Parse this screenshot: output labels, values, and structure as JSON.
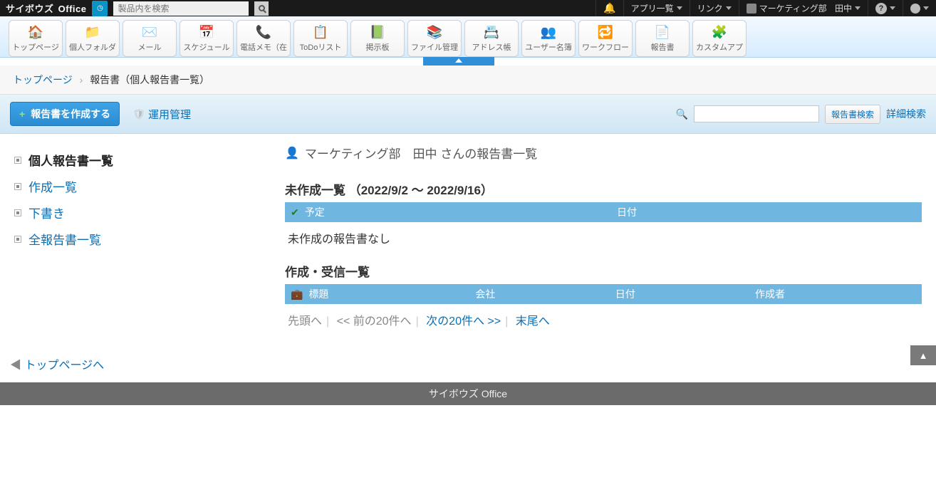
{
  "top": {
    "logo_small": "サイボウズ",
    "logo_main": "Office",
    "search_placeholder": "製品内を検索",
    "apps_label": "アプリ一覧",
    "links_label": "リンク",
    "user_dept": "マーケティング部",
    "user_name": "田中"
  },
  "apps": [
    {
      "label": "トップページ",
      "icon": "🏠"
    },
    {
      "label": "個人フォルダ",
      "icon": "📁"
    },
    {
      "label": "メール",
      "icon": "✉️"
    },
    {
      "label": "スケジュール",
      "icon": "📅"
    },
    {
      "label": "電話メモ（在",
      "icon": "📞"
    },
    {
      "label": "ToDoリスト",
      "icon": "📋"
    },
    {
      "label": "掲示板",
      "icon": "📗"
    },
    {
      "label": "ファイル管理",
      "icon": "📚"
    },
    {
      "label": "アドレス帳",
      "icon": "📇"
    },
    {
      "label": "ユーザー名簿",
      "icon": "👥"
    },
    {
      "label": "ワークフロー",
      "icon": "🔁"
    },
    {
      "label": "報告書",
      "icon": "📄"
    },
    {
      "label": "カスタムアプ",
      "icon": "🧩"
    }
  ],
  "breadcrumb": {
    "top": "トップページ",
    "current": "報告書（個人報告書一覧）"
  },
  "action": {
    "create_label": "報告書を作成する",
    "admin_label": "運用管理",
    "search_btn": "報告書検索",
    "detail_search": "詳細検索"
  },
  "sidebar": {
    "items": [
      {
        "label": "個人報告書一覧",
        "active": true
      },
      {
        "label": "作成一覧",
        "active": false
      },
      {
        "label": "下書き",
        "active": false
      },
      {
        "label": "全報告書一覧",
        "active": false
      }
    ]
  },
  "main": {
    "title": "マーケティング部　田中 さんの報告書一覧",
    "uncreated": {
      "title": "未作成一覧 （2022/9/2 〜 2022/9/16）",
      "col_schedule": "予定",
      "col_date": "日付",
      "none": "未作成の報告書なし"
    },
    "createdList": {
      "title": "作成・受信一覧",
      "col_title": "標題",
      "col_company": "会社",
      "col_date": "日付",
      "col_author": "作成者"
    },
    "pager": {
      "first": "先頭へ",
      "prev": "<< 前の20件へ",
      "next": "次の20件へ >>",
      "last": "末尾へ"
    }
  },
  "back_top": "トップページへ",
  "footer": "サイボウズ Office"
}
